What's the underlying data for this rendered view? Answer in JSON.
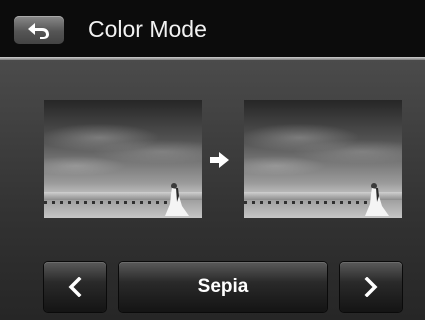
{
  "header": {
    "title": "Color Mode",
    "back_icon": "back-arrow-icon"
  },
  "preview": {
    "original_image": "beach-wedding-photo",
    "converted_image": "beach-wedding-photo-sepia",
    "arrow_icon": "arrow-right-icon"
  },
  "selector": {
    "prev_icon": "chevron-left-icon",
    "current_mode": "Sepia",
    "next_icon": "chevron-right-icon"
  },
  "colors": {
    "header_bg": "#0c0c0c",
    "title_text": "#f2f2f2",
    "button_text": "#ffffff"
  }
}
